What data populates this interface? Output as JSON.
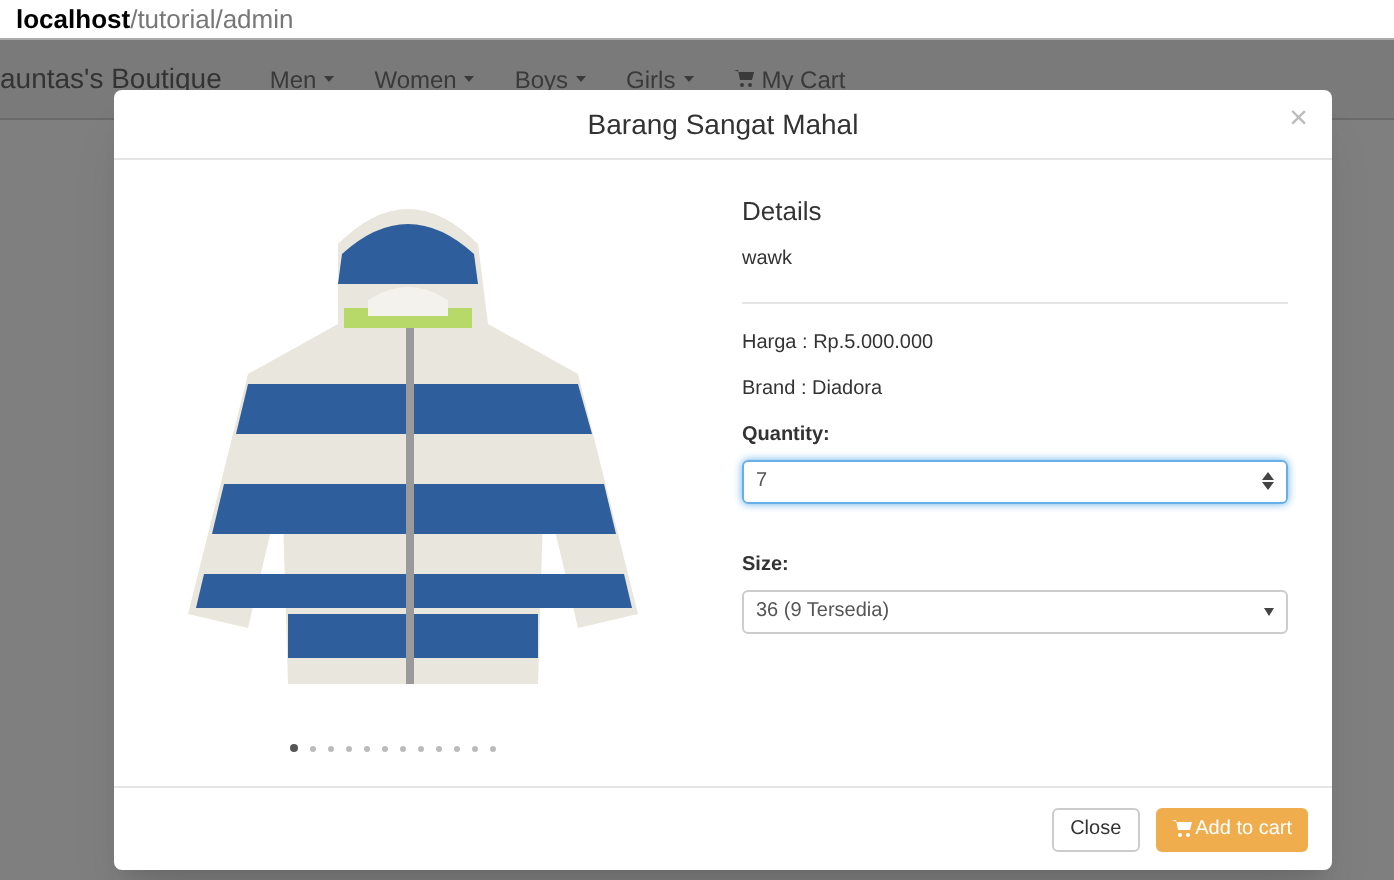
{
  "address_bar": {
    "host": "localhost",
    "path": "/tutorial/admin"
  },
  "navbar": {
    "brand": "auntas's Boutique",
    "items": [
      {
        "label": "Men",
        "kind": "dropdown"
      },
      {
        "label": "Women",
        "kind": "dropdown"
      },
      {
        "label": "Boys",
        "kind": "dropdown"
      },
      {
        "label": "Girls",
        "kind": "dropdown"
      },
      {
        "label": "My Cart",
        "kind": "cart"
      }
    ]
  },
  "modal": {
    "title": "Barang Sangat Mahal",
    "close": "×",
    "carousel_dots": [
      {
        "selected": true
      },
      {
        "selected": false
      },
      {
        "selected": false
      },
      {
        "selected": false
      },
      {
        "selected": false
      },
      {
        "selected": false
      },
      {
        "selected": false
      },
      {
        "selected": false
      },
      {
        "selected": false
      },
      {
        "selected": false
      },
      {
        "selected": false
      },
      {
        "selected": false
      }
    ],
    "details_heading": "Details",
    "description": "wawk",
    "price": "Harga : Rp.5.000.000",
    "brand": "Brand : Diadora",
    "quantity": {
      "label": "Quantity:",
      "value": "7"
    },
    "size": {
      "label": "Size:",
      "value": "36 (9 Tersedia)"
    },
    "buttons": [
      {
        "label": "Close",
        "kind": "default"
      },
      {
        "label": "Add to cart",
        "kind": "cart"
      }
    ]
  }
}
